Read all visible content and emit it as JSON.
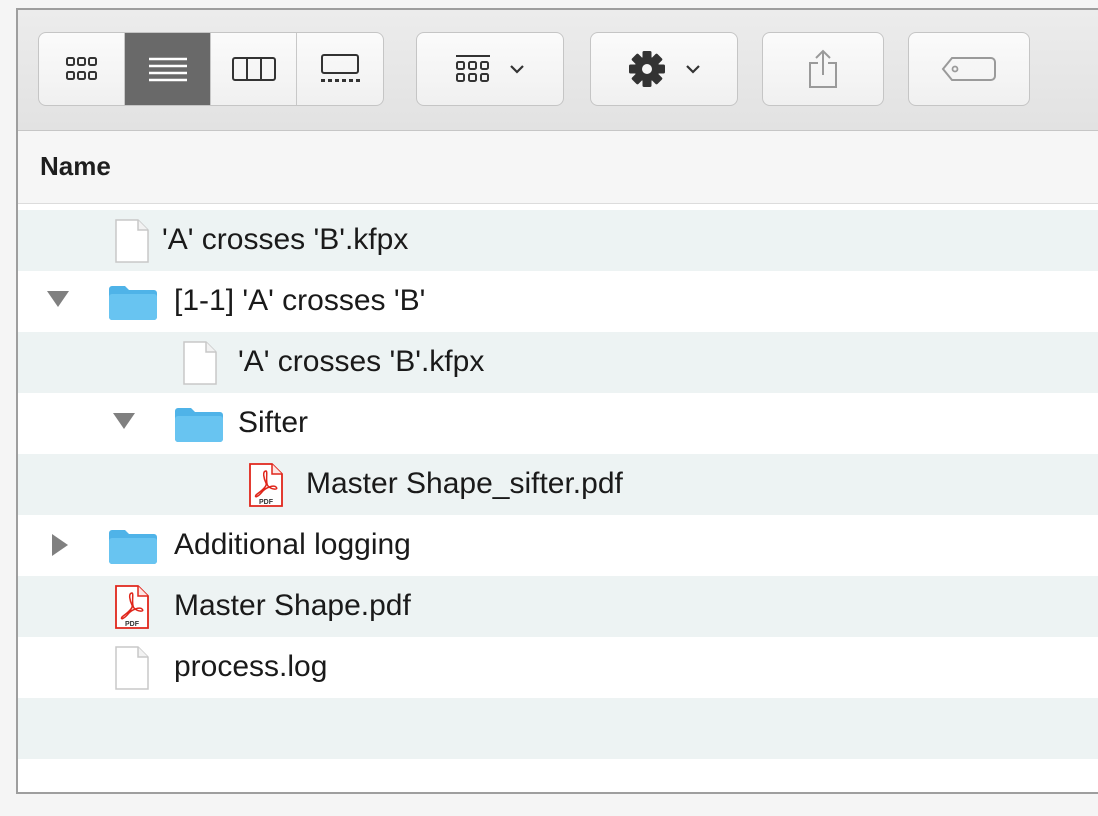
{
  "toolbar": {
    "view_buttons": [
      "icon-view-icon",
      "list-view-icon",
      "column-view-icon",
      "gallery-view-icon"
    ],
    "active_view": "list-view-icon",
    "group_icon": "group-grid-icon",
    "action_icon": "gear-icon",
    "share_icon": "share-icon",
    "tag_icon": "tag-icon"
  },
  "header": {
    "name_label": "Name"
  },
  "files": [
    {
      "name": "'A' crosses 'B'.kfpx",
      "type": "document",
      "indent": 0,
      "disclosure": "none"
    },
    {
      "name": "[1-1] 'A' crosses 'B'",
      "type": "folder",
      "indent": 0,
      "disclosure": "expanded"
    },
    {
      "name": "'A' crosses 'B'.kfpx",
      "type": "document",
      "indent": 1,
      "disclosure": "none"
    },
    {
      "name": "Sifter",
      "type": "folder",
      "indent": 1,
      "disclosure": "expanded"
    },
    {
      "name": "Master Shape_sifter.pdf",
      "type": "pdf",
      "indent": 2,
      "disclosure": "none"
    },
    {
      "name": "Additional logging",
      "type": "folder",
      "indent": 0,
      "disclosure": "collapsed"
    },
    {
      "name": "Master Shape.pdf",
      "type": "pdf",
      "indent": 0,
      "disclosure": "none"
    },
    {
      "name": "process.log",
      "type": "document",
      "indent": 0,
      "disclosure": "none"
    }
  ],
  "colors": {
    "folder": "#62c0ee",
    "pdf": "#e0261b",
    "row_alt": "#edf3f3",
    "active_segment": "#696969"
  }
}
